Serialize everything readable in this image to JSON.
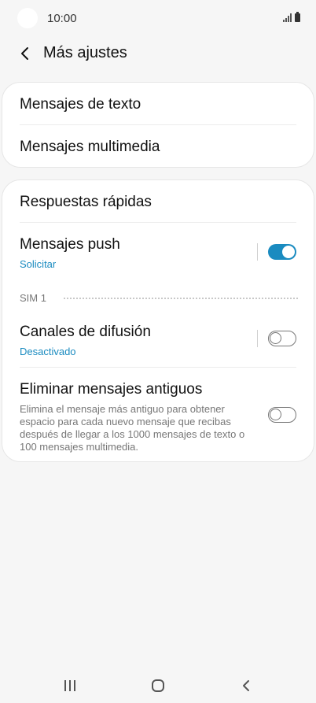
{
  "status_bar": {
    "time": "10:00",
    "icons": [
      "signal-icon",
      "battery-icon"
    ]
  },
  "header": {
    "title": "Más ajustes",
    "back_icon": "chevron-left-icon"
  },
  "group1": {
    "items": [
      {
        "label": "Mensajes de texto"
      },
      {
        "label": "Mensajes multimedia"
      }
    ]
  },
  "group2": {
    "quick_replies": {
      "label": "Respuestas rápidas"
    },
    "push": {
      "label": "Mensajes push",
      "sub": "Solicitar",
      "enabled": true
    },
    "section_label": "SIM 1",
    "broadcast": {
      "label": "Canales de difusión",
      "sub": "Desactivado",
      "enabled": false
    },
    "delete_old": {
      "label": "Eliminar mensajes antiguos",
      "description": "Elimina el mensaje más antiguo para obtener espacio para cada nuevo mensaje que recibas después de llegar a los 1000 mensajes de texto o 100 mensajes multimedia.",
      "enabled": false
    }
  },
  "colors": {
    "accent": "#1a8bc0",
    "background": "#f6f6f6",
    "card": "#ffffff"
  },
  "navbar": {
    "icons": [
      "recent-apps-icon",
      "home-icon",
      "back-icon"
    ]
  }
}
